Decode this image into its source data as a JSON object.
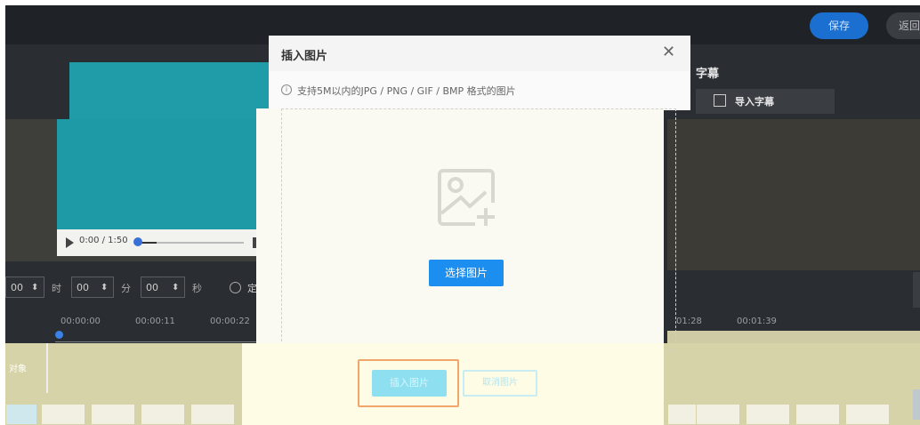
{
  "toolbar": {
    "save_label": "保存",
    "back_label": "返回"
  },
  "player": {
    "time": "0:00 / 1:50"
  },
  "time_inputs": {
    "hours": "00",
    "hours_unit": "时",
    "minutes": "00",
    "minutes_unit": "分",
    "seconds": "00",
    "seconds_unit": "秒",
    "stepper_glyph": "⬍",
    "add_partial": "定"
  },
  "timeline": {
    "ticks_left": [
      "00:00:00",
      "00:00:11",
      "00:00:22"
    ],
    "ticks_right": [
      "01:28",
      "00:01:39"
    ],
    "track_label": "对象"
  },
  "right_panel": {
    "title": "字幕",
    "import_label": "导入字幕"
  },
  "modal": {
    "title": "插入图片",
    "close_glyph": "✕",
    "info_text": "支持5M以内的JPG / PNG / GIF / BMP 格式的图片",
    "choose_label": "选择图片",
    "insert_label": "插入图片",
    "cancel_label": "取消图片"
  },
  "colors": {
    "accent": "#1b8ef0",
    "save": "#1a6fd1",
    "highlight": "#f0a56a"
  }
}
